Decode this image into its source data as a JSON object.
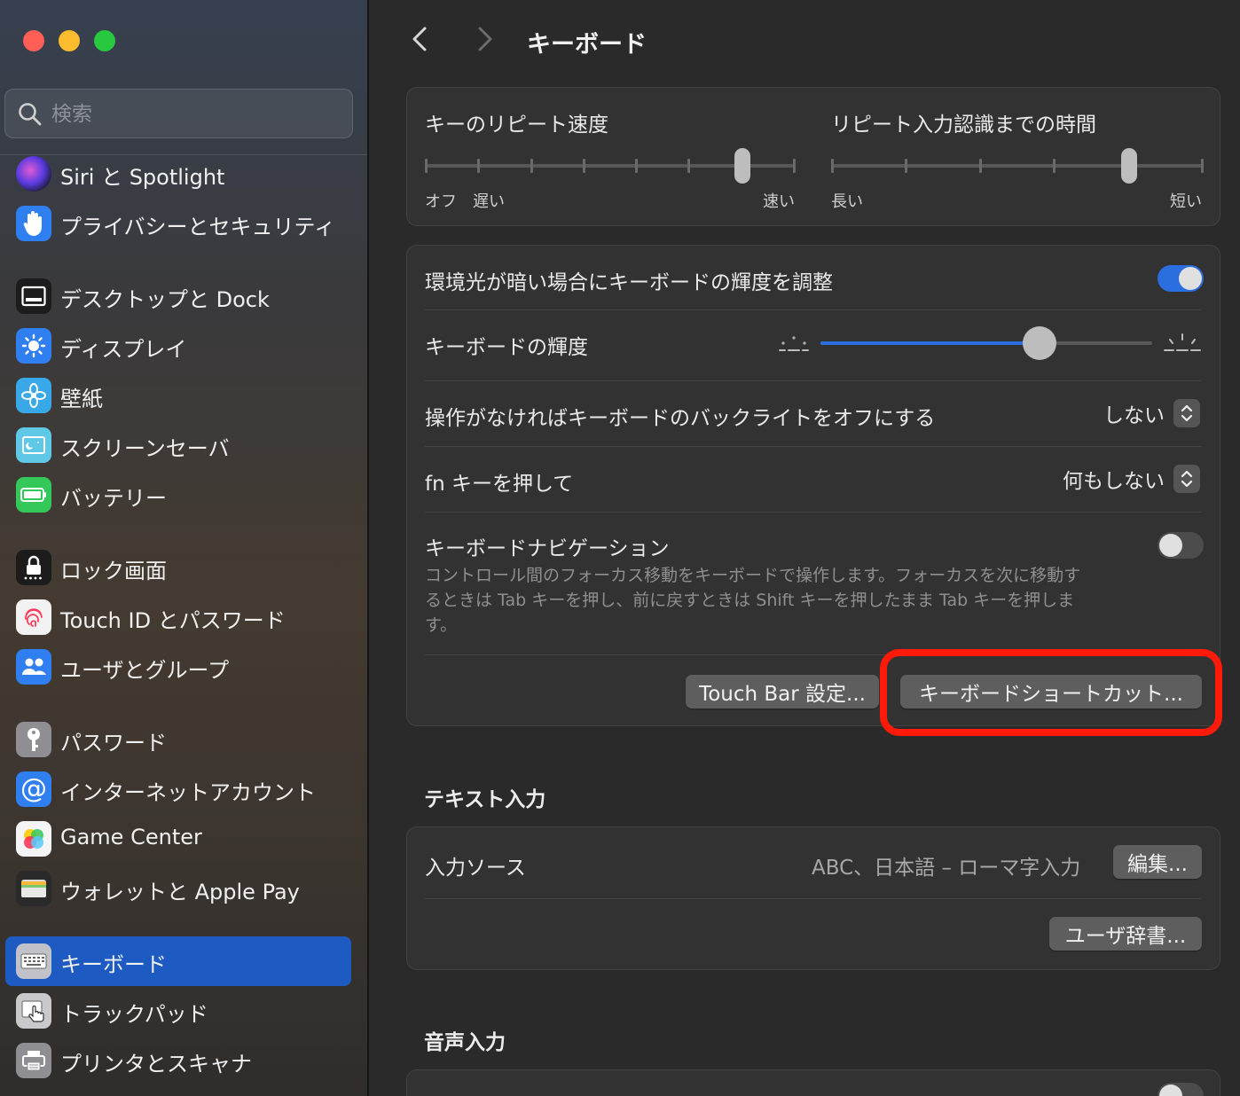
{
  "window": {
    "title": "キーボード",
    "traffic_lights": [
      "close",
      "minimize",
      "zoom"
    ]
  },
  "search": {
    "placeholder": "検索",
    "value": ""
  },
  "sidebar": {
    "items": [
      {
        "label": "Siri と Spotlight",
        "icon": "siri-icon"
      },
      {
        "label": "プライバシーとセキュリティ",
        "icon": "privacy-hand-icon"
      },
      {
        "label": "デスクトップと Dock",
        "icon": "desktop-dock-icon"
      },
      {
        "label": "ディスプレイ",
        "icon": "display-sun-icon"
      },
      {
        "label": "壁紙",
        "icon": "wallpaper-flower-icon"
      },
      {
        "label": "スクリーンセーバ",
        "icon": "screensaver-icon"
      },
      {
        "label": "バッテリー",
        "icon": "battery-icon"
      },
      {
        "label": "ロック画面",
        "icon": "lock-screen-icon"
      },
      {
        "label": "Touch ID とパスワード",
        "icon": "fingerprint-icon"
      },
      {
        "label": "ユーザとグループ",
        "icon": "users-icon"
      },
      {
        "label": "パスワード",
        "icon": "key-icon"
      },
      {
        "label": "インターネットアカウント",
        "icon": "at-sign-icon"
      },
      {
        "label": "Game Center",
        "icon": "game-center-icon"
      },
      {
        "label": "ウォレットと Apple Pay",
        "icon": "wallet-icon"
      },
      {
        "label": "キーボード",
        "icon": "keyboard-icon",
        "selected": true
      },
      {
        "label": "トラックパッド",
        "icon": "trackpad-icon"
      },
      {
        "label": "プリンタとスキャナ",
        "icon": "printer-icon"
      }
    ]
  },
  "header": {
    "title": "キーボード"
  },
  "repeat": {
    "rate_label": "キーのリピート速度",
    "rate_off": "オフ",
    "rate_slow": "遅い",
    "rate_fast": "速い",
    "rate_level": 7,
    "rate_steps": 8,
    "delay_label": "リピート入力認識までの時間",
    "delay_long": "長い",
    "delay_short": "短い",
    "delay_level": 4,
    "delay_steps": 6
  },
  "settings": {
    "ambient_label": "環境光が暗い場合にキーボードの輝度を調整",
    "ambient_on": true,
    "brightness_label": "キーボードの輝度",
    "brightness_value": 0.66,
    "backlight_off_label": "操作がなければキーボードのバックライトをオフにする",
    "backlight_off_value": "しない",
    "fn_label": "fn キーを押して",
    "fn_value": "何もしない",
    "nav_label": "キーボードナビゲーション",
    "nav_on": false,
    "nav_desc": "コントロール間のフォーカス移動をキーボードで操作します。フォーカスを次に移動するときは Tab キーを押し、前に戻すときは Shift キーを押したまま Tab キーを押します。",
    "touchbar_button": "Touch Bar 設定...",
    "shortcuts_button": "キーボードショートカット..."
  },
  "text_input": {
    "section_title": "テキスト入力",
    "input_sources_label": "入力ソース",
    "input_sources_value": "ABC、日本語 – ローマ字入力",
    "edit_button": "編集...",
    "user_dict_button": "ユーザ辞書..."
  },
  "dictation": {
    "section_title": "音声入力"
  },
  "colors": {
    "accent": "#1d5bc2",
    "toggle_on": "#2a6ee0",
    "highlight": "#ff1a0a"
  }
}
